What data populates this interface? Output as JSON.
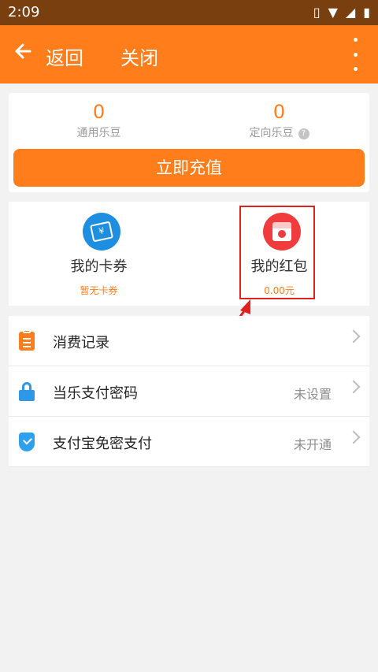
{
  "status_bar": {
    "time": "2:09"
  },
  "app_bar": {
    "back_label": "返回",
    "close_label": "关闭"
  },
  "balances": {
    "general": {
      "value": "0",
      "label": "通用乐豆"
    },
    "directed": {
      "value": "0",
      "label": "定向乐豆"
    }
  },
  "recharge_button": "立即充值",
  "wallet": {
    "card": {
      "title": "我的卡券",
      "subtitle": "暂无卡券"
    },
    "redpacket": {
      "title": "我的红包",
      "subtitle": "0.00元"
    }
  },
  "menu": [
    {
      "label": "消费记录",
      "value": "",
      "icon": "clipboard-icon"
    },
    {
      "label": "当乐支付密码",
      "value": "未设置",
      "icon": "lock-icon"
    },
    {
      "label": "支付宝免密支付",
      "value": "未开通",
      "icon": "shield-icon"
    }
  ],
  "colors": {
    "brand": "#ff7d1a",
    "status_bar": "#7a3f0f",
    "highlight": "#e0211d"
  }
}
